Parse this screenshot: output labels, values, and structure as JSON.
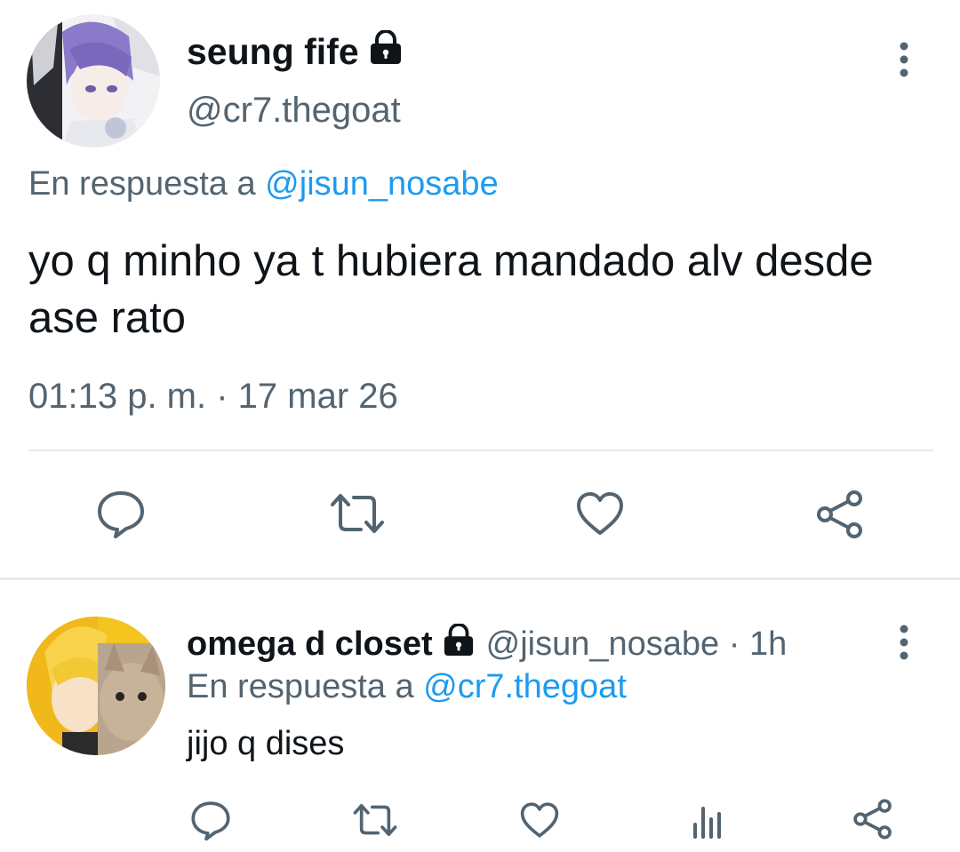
{
  "main_tweet": {
    "display_name": "seung fife",
    "handle": "@cr7.thegoat",
    "reply_prefix": "En respuesta a",
    "reply_to": "@jisun_nosabe",
    "text": "yo q minho ya t hubiera mandado alv desde ase rato",
    "timestamp": "01:13 p. m. · 17 mar 26",
    "actions": [
      "reply-icon",
      "retweet-icon",
      "like-icon",
      "share-icon"
    ]
  },
  "reply_tweet": {
    "display_name": "omega d closet",
    "handle_and_time": "@jisun_nosabe · 1h",
    "reply_prefix": "En respuesta a",
    "reply_to": "@cr7.thegoat",
    "text": "jijo q dises",
    "actions": [
      "reply-icon",
      "retweet-icon",
      "like-icon",
      "analytics-icon",
      "share-icon"
    ]
  },
  "colors": {
    "text_primary": "#0f1419",
    "text_secondary": "#536471",
    "mention": "#1d9bf0",
    "icon": "#536471",
    "divider": "#e6e9ec"
  }
}
